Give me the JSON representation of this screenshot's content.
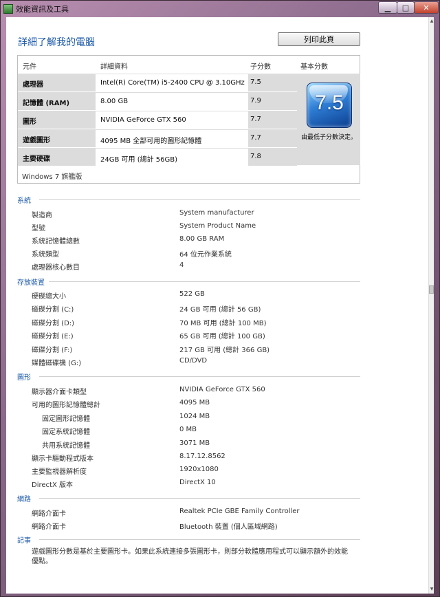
{
  "window": {
    "title": "效能資訊及工具"
  },
  "page": {
    "heading": "詳細了解我的電腦",
    "print_button": "列印此頁"
  },
  "scores": {
    "headers": [
      "元件",
      "詳細資料",
      "子分數",
      "基本分數"
    ],
    "rows": [
      {
        "component": "處理器",
        "detail": "Intel(R) Core(TM) i5-2400 CPU @ 3.10GHz",
        "subscore": "7.5"
      },
      {
        "component": "記憶體 (RAM)",
        "detail": "8.00 GB",
        "subscore": "7.9"
      },
      {
        "component": "圖形",
        "detail": "NVIDIA GeForce GTX 560",
        "subscore": "7.7"
      },
      {
        "component": "遊戲圖形",
        "detail": "4095 MB 全部可用的圖形記憶體",
        "subscore": "7.7"
      },
      {
        "component": "主要硬碟",
        "detail": "24GB 可用 (總計 56GB)",
        "subscore": "7.8"
      }
    ],
    "base_score": "7.5",
    "base_caption": "由最低子分數決定。",
    "edition": "Windows 7 旗艦版"
  },
  "sections": {
    "system": {
      "title": "系統",
      "items": [
        {
          "label": "製造商",
          "value": "System manufacturer"
        },
        {
          "label": "型號",
          "value": "System Product Name"
        },
        {
          "label": "系統記憶體總數",
          "value": "8.00 GB RAM"
        },
        {
          "label": "系統類型",
          "value": "64 位元作業系統"
        },
        {
          "label": "處理器核心數目",
          "value": "4"
        }
      ]
    },
    "storage": {
      "title": "存放裝置",
      "items": [
        {
          "label": "硬碟總大小",
          "value": "522 GB"
        },
        {
          "label": "磁碟分割 (C:)",
          "value": "24 GB 可用 (總計 56 GB)"
        },
        {
          "label": "磁碟分割 (D:)",
          "value": "70 MB 可用 (總計 100 MB)"
        },
        {
          "label": "磁碟分割 (E:)",
          "value": "65 GB 可用 (總計 100 GB)"
        },
        {
          "label": "磁碟分割 (F:)",
          "value": "217 GB 可用 (總計 366 GB)"
        },
        {
          "label": "媒體磁碟機 (G:)",
          "value": "CD/DVD"
        }
      ]
    },
    "graphics": {
      "title": "圖形",
      "items": [
        {
          "label": "顯示器介面卡類型",
          "value": "NVIDIA GeForce GTX 560"
        },
        {
          "label": "可用的圖形記憶體總計",
          "value": "4095 MB"
        },
        {
          "label": "固定圖形記憶體",
          "value": "1024 MB"
        },
        {
          "label": "固定系統記憶體",
          "value": "0 MB"
        },
        {
          "label": "共用系統記憶體",
          "value": "3071 MB"
        },
        {
          "label": "顯示卡驅動程式版本",
          "value": "8.17.12.8562"
        },
        {
          "label": "主要監視器解析度",
          "value": "1920x1080"
        },
        {
          "label": "DirectX 版本",
          "value": "DirectX 10"
        }
      ]
    },
    "network": {
      "title": "網路",
      "items": [
        {
          "label": "網路介面卡",
          "value": "Realtek PCIe GBE Family Controller"
        },
        {
          "label": "網路介面卡",
          "value": "Bluetooth 裝置 (個人區域網路)"
        }
      ]
    },
    "notes": {
      "title": "記事",
      "text": "遊戲圖形分數是基於主要圖形卡。如果此系統連接多張圖形卡，則部分軟體應用程式可以顯示額外的效能優點。"
    }
  }
}
